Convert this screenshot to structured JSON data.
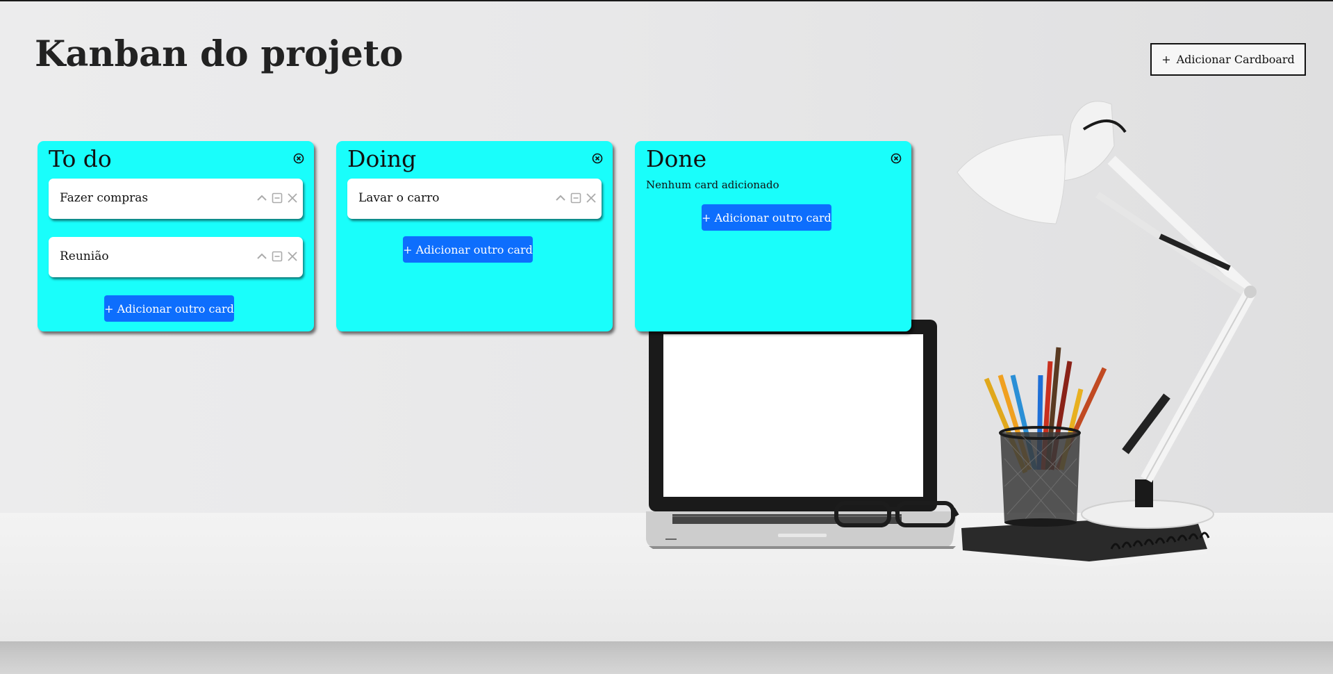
{
  "page": {
    "title": "Kanban do projeto",
    "add_board_label": "Adicionar Cardboard",
    "add_board_icon": "plus-icon"
  },
  "colors": {
    "board": "#19fefb",
    "primary_button": "#0d6efd"
  },
  "boards": [
    {
      "title": "To do",
      "close_icon": "circle-x-icon",
      "cards": [
        {
          "text": "Fazer compras",
          "icons": [
            "chevron-up-icon",
            "minus-square-icon",
            "close-icon"
          ]
        },
        {
          "text": "Reunião",
          "icons": [
            "chevron-up-icon",
            "minus-square-icon",
            "close-icon"
          ]
        }
      ],
      "add_card_label": "+ Adicionar outro card"
    },
    {
      "title": "Doing",
      "close_icon": "circle-x-icon",
      "cards": [
        {
          "text": "Lavar o carro",
          "icons": [
            "chevron-up-icon",
            "minus-square-icon",
            "close-icon"
          ]
        }
      ],
      "add_card_label": "+ Adicionar outro card"
    },
    {
      "title": "Done",
      "close_icon": "circle-x-icon",
      "cards": [],
      "empty_text": "Nenhum card adicionado",
      "add_card_label": "+ Adicionar outro card"
    }
  ]
}
